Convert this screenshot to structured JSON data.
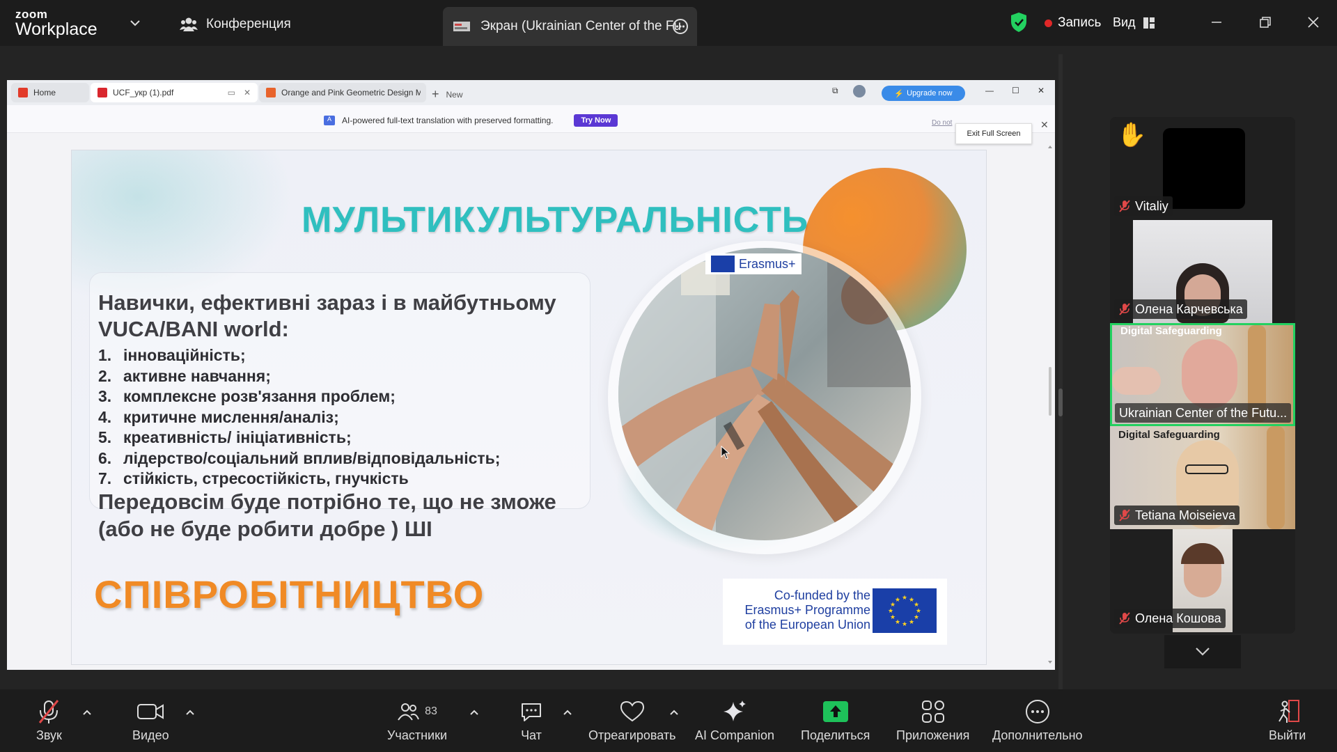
{
  "app": {
    "logo_top": "zoom",
    "logo_bottom": "Workplace",
    "meeting_label": "Конференция",
    "share_tab_label": "Экран (Ukrainian Center of the Fu",
    "record_label": "Запись",
    "view_label": "Вид"
  },
  "viewer": {
    "tabs": [
      {
        "label": "Home"
      },
      {
        "label": "UCF_укр (1).pdf"
      },
      {
        "label": "Orange and Pink Geometric Design M"
      }
    ],
    "new_tab": "New",
    "upgrade": "Upgrade now",
    "notice": "AI-powered full-text translation with preserved formatting.",
    "try_now": "Try Now",
    "do_not": "Do not",
    "exit_fullscreen": "Exit Full Screen"
  },
  "slide": {
    "title": "МУЛЬТИКУЛЬТУРАЛЬНІСТЬ",
    "heading_line1": "Навички, ефективні зараз і в майбутньому",
    "heading_line2": "VUCA/BANI world:",
    "items": [
      {
        "num": "1.",
        "text": "інноваційність;"
      },
      {
        "num": "2.",
        "text": "активне навчання;"
      },
      {
        "num": "3.",
        "text": "комплексне розв'язання проблем;"
      },
      {
        "num": "4.",
        "text": "критичне мислення/аналіз;"
      },
      {
        "num": "5.",
        "text": "креативність/ ініціативність;"
      },
      {
        "num": "6.",
        "text": "лідерство/соціальний вплив/відповідальність;"
      },
      {
        "num": "7.",
        "text": "стійкість, стресостійкість, гнучкість"
      }
    ],
    "conclusion_line1": "Передовсім буде потрібно те, що не зможе",
    "conclusion_line2": "(або не буде робити добре ) ШІ",
    "cooperation": "СПІВРОБІТНИЦТВО",
    "erasmus_badge": "Erasmus+",
    "eu_line1": "Co-funded by the",
    "eu_line2": "Erasmus+ Programme",
    "eu_line3": "of the European Union"
  },
  "participants": [
    {
      "name": "Vitaliy",
      "hand_raised": true,
      "muted": true
    },
    {
      "name": "Олена Карчевська",
      "muted": true
    },
    {
      "name": "Ukrainian Center of the Futu...",
      "active_speaker": true,
      "bg_text": "Digital Safeguarding"
    },
    {
      "name": "Tetiana Moiseieva",
      "muted": true,
      "bg_text": "Digital Safeguarding"
    },
    {
      "name": "Олена Кошова",
      "muted": true
    }
  ],
  "toolbar": {
    "audio": "Звук",
    "video": "Видео",
    "participants": "Участники",
    "participants_count": "83",
    "chat": "Чат",
    "react": "Отреагировать",
    "ai": "AI Companion",
    "share": "Поделиться",
    "apps": "Приложения",
    "more": "Дополнительно",
    "leave": "Выйти"
  },
  "colors": {
    "accent_green": "#23d160",
    "record_red": "#e02828",
    "title_teal": "#2fbfbf",
    "cooperation_orange": "#f08a25",
    "upgrade_blue": "#3a8be8",
    "try_now_purple": "#5b38d4"
  }
}
